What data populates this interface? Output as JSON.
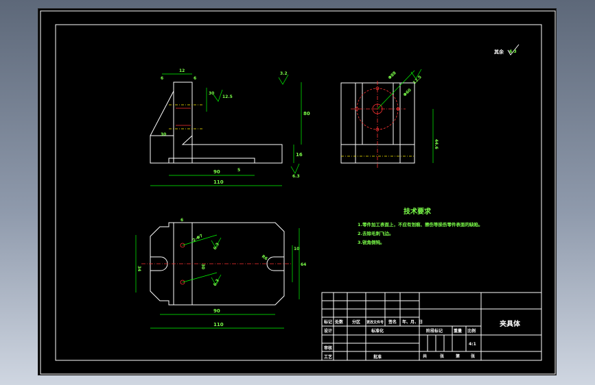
{
  "dimensions": {
    "front": {
      "d6a": "6",
      "d12": "12",
      "d6b": "6",
      "d30": "30",
      "d12_5": "12.5",
      "d3_2": "3.2",
      "d80": "80",
      "d16": "16",
      "d30b": "30",
      "d90": "90",
      "d110": "110",
      "d5": "5",
      "d6_3": "6.3"
    },
    "side": {
      "d88": "Φ88",
      "d12_5": "12.5",
      "d60": "Φ60",
      "d44_6": "44.6"
    },
    "top": {
      "d6": "6",
      "d2x7": "2-Φ7",
      "d6_3a": "6.3",
      "d30": "30",
      "d6_3b": "6.3",
      "d34": "34",
      "d10": "10",
      "d64": "64",
      "d90": "90",
      "d110": "110",
      "r6": "R6"
    },
    "corner": {
      "roughness_label": "其余",
      "roughness_value": "6.3"
    }
  },
  "technical_requirements": {
    "title": "技术要求",
    "items": [
      "1.零件加工表面上，不应有划痕、擦伤等损伤零件表面的缺陷。",
      "2.去除毛刺飞边。",
      "3.锐角倒钝。"
    ]
  },
  "title_block": {
    "part_name": "夹具体",
    "row_labels": [
      "标记",
      "处数",
      "分区",
      "更改文件号",
      "签名",
      "年、月、日"
    ],
    "design": "设计",
    "standardize": "标准化",
    "stage_mark": "阶段标记",
    "weight": "重量",
    "scale": "比例",
    "scale_value": "4:1",
    "review": "审核",
    "process": "工艺",
    "approve": "批准",
    "sheets_total": "共",
    "sheet_no": "张",
    "sheet_of": "第",
    "sheet_end": "张"
  }
}
